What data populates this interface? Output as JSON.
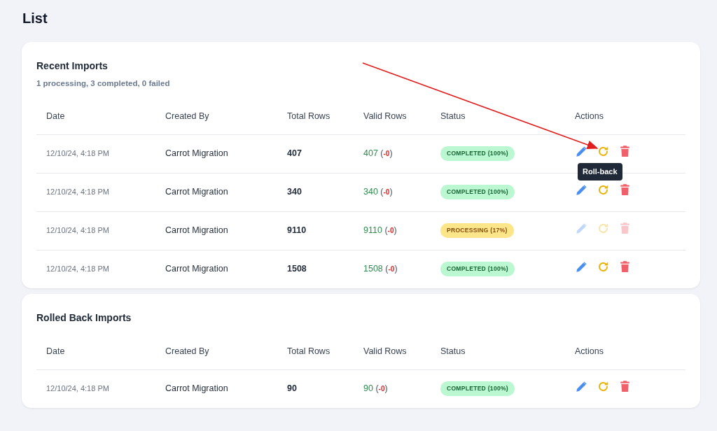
{
  "page": {
    "title": "List"
  },
  "sections": [
    {
      "title": "Recent Imports",
      "subtitle": "1 processing, 3 completed, 0 failed",
      "columns": [
        "Date",
        "Created By",
        "Total Rows",
        "Valid Rows",
        "Status",
        "Actions"
      ],
      "rows": [
        {
          "date": "12/10/24, 4:18 PM",
          "created_by": "Carrot Migration",
          "total": "407",
          "valid": "407",
          "invalid": {
            "open": "(",
            "value": "-0",
            "close": ")"
          },
          "status": {
            "kind": "completed",
            "label": "COMPLETED (100%)"
          },
          "actions_disabled": false,
          "tooltip": "Roll-back"
        },
        {
          "date": "12/10/24, 4:18 PM",
          "created_by": "Carrot Migration",
          "total": "340",
          "valid": "340",
          "invalid": {
            "open": "(",
            "value": "-0",
            "close": ")"
          },
          "status": {
            "kind": "completed",
            "label": "COMPLETED (100%)"
          },
          "actions_disabled": false
        },
        {
          "date": "12/10/24, 4:18 PM",
          "created_by": "Carrot Migration",
          "total": "9110",
          "valid": "9110",
          "invalid": {
            "open": "(",
            "value": "-0",
            "close": ")"
          },
          "status": {
            "kind": "processing",
            "label": "PROCESSING (17%)"
          },
          "actions_disabled": true
        },
        {
          "date": "12/10/24, 4:18 PM",
          "created_by": "Carrot Migration",
          "total": "1508",
          "valid": "1508",
          "invalid": {
            "open": "(",
            "value": "-0",
            "close": ")"
          },
          "status": {
            "kind": "completed",
            "label": "COMPLETED (100%)"
          },
          "actions_disabled": false
        }
      ]
    },
    {
      "title": "Rolled Back Imports",
      "columns": [
        "Date",
        "Created By",
        "Total Rows",
        "Valid Rows",
        "Status",
        "Actions"
      ],
      "rows": [
        {
          "date": "12/10/24, 4:18 PM",
          "created_by": "Carrot Migration",
          "total": "90",
          "valid": "90",
          "invalid": {
            "open": "(",
            "value": "-0",
            "close": ")"
          },
          "status": {
            "kind": "completed",
            "label": "COMPLETED (100%)"
          },
          "actions_disabled": false
        }
      ]
    }
  ]
}
